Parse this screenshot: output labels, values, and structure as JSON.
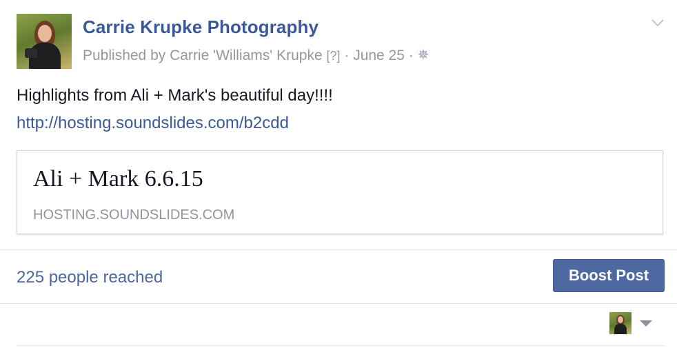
{
  "post": {
    "page_name": "Carrie Krupke Photography",
    "published_by": "Published by Carrie 'Williams' Krupke",
    "help_marker": "[?]",
    "separator": "·",
    "date": "June 25",
    "audience_icon": "gear-icon",
    "text": "Highlights from Ali + Mark's beautiful day!!!!",
    "link": "http://hosting.soundslides.com/b2cdd"
  },
  "link_card": {
    "title": "Ali + Mark 6.6.15",
    "domain": "HOSTING.SOUNDSLIDES.COM"
  },
  "stats": {
    "reach": "225 people reached",
    "boost_label": "Boost Post"
  },
  "colors": {
    "brand_blue": "#3b5998",
    "boost_button": "#4e69a2",
    "meta_gray": "#9197a3"
  }
}
